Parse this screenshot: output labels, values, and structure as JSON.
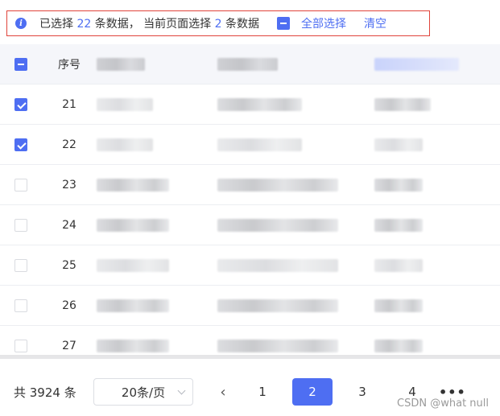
{
  "alert": {
    "text_prefix": "已选择",
    "selected_count": "22",
    "text_mid": "条数据，  当前页面选择",
    "page_count": "2",
    "text_suffix": "条数据",
    "select_all": "全部选择",
    "clear": "清空"
  },
  "table": {
    "header": {
      "index": "序号"
    },
    "rows": [
      {
        "index": "21",
        "checked": true
      },
      {
        "index": "22",
        "checked": true
      },
      {
        "index": "23",
        "checked": false
      },
      {
        "index": "24",
        "checked": false
      },
      {
        "index": "25",
        "checked": false
      },
      {
        "index": "26",
        "checked": false
      },
      {
        "index": "27",
        "checked": false
      }
    ]
  },
  "pagination": {
    "total": "共 3924 条",
    "page_size": "20条/页",
    "pages": [
      "1",
      "2",
      "3",
      "4"
    ],
    "current": "2",
    "more": "•••"
  },
  "watermark": "CSDN @what null",
  "colors": {
    "accent": "#4e6ef2",
    "alert_border": "#e0443b"
  }
}
